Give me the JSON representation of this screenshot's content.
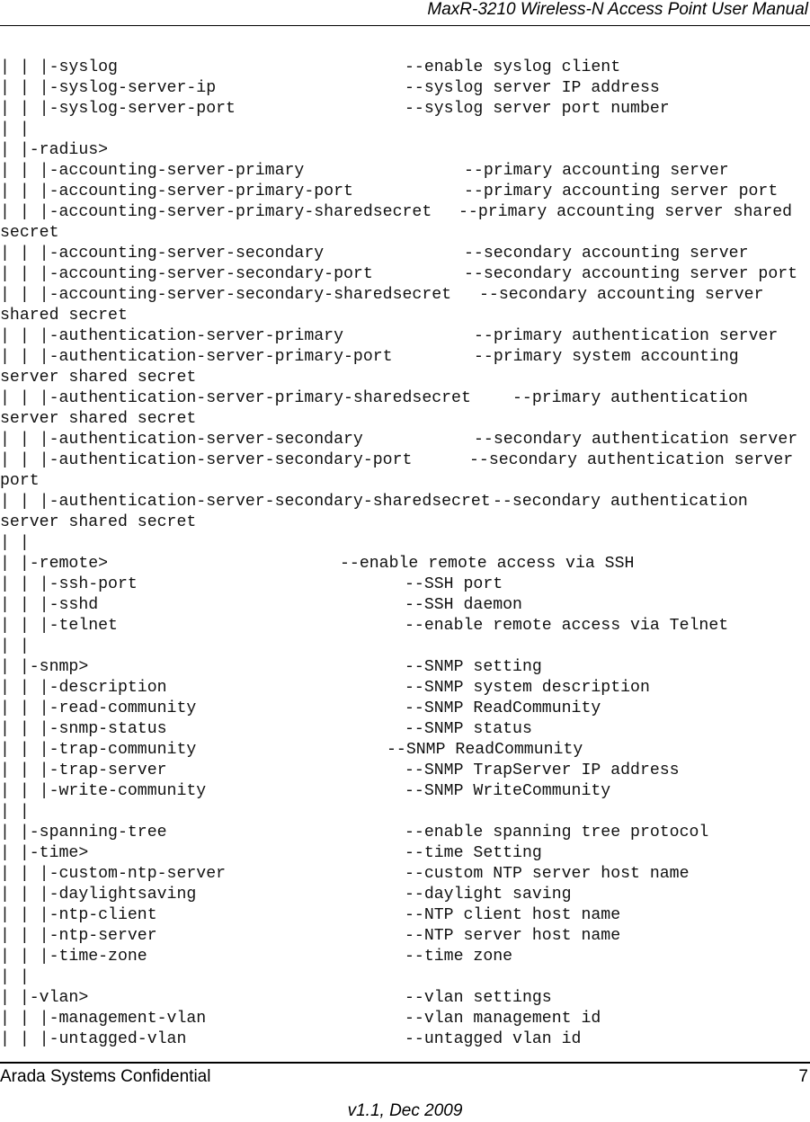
{
  "header": {
    "title": "MaxR-3210 Wireless-N Access Point User Manual"
  },
  "lines": [
    {
      "tree": "| | |-syslog",
      "desc": "--enable syslog client",
      "col": 450
    },
    {
      "tree": "| | |-syslog-server-ip",
      "desc": "--syslog server IP address",
      "col": 450
    },
    {
      "tree": "| | |-syslog-server-port",
      "desc": "--syslog server port number",
      "col": 450
    },
    {
      "tree": "| |",
      "desc": "",
      "col": 0
    },
    {
      "tree": "| |-radius>",
      "desc": "",
      "col": 0
    },
    {
      "tree": "| | |-accounting-server-primary",
      "desc": "--primary accounting server",
      "col": 516
    },
    {
      "tree": "| | |-accounting-server-primary-port",
      "desc": "--primary accounting server port",
      "col": 516
    },
    {
      "tree": "| | |-accounting-server-primary-sharedsecret",
      "desc": "--primary accounting server shared",
      "col": 510
    },
    {
      "tree": "secret",
      "desc": "",
      "col": 0
    },
    {
      "tree": "| | |-accounting-server-secondary",
      "desc": "--secondary accounting server",
      "col": 516
    },
    {
      "tree": "| | |-accounting-server-secondary-port",
      "desc": "--secondary accounting server port",
      "col": 516
    },
    {
      "tree": "| | |-accounting-server-secondary-sharedsecret",
      "desc": "--secondary accounting server",
      "col": 533
    },
    {
      "tree": "shared secret",
      "desc": "",
      "col": 0
    },
    {
      "tree": "| | |-authentication-server-primary",
      "desc": "--primary authentication server",
      "col": 527
    },
    {
      "tree": "| | |-authentication-server-primary-port",
      "desc": "--primary system accounting",
      "col": 527
    },
    {
      "tree": "server shared secret",
      "desc": "",
      "col": 0
    },
    {
      "tree": "| | |-authentication-server-primary-sharedsecret",
      "desc": "--primary authentication",
      "col": 570
    },
    {
      "tree": "server shared secret",
      "desc": "",
      "col": 0
    },
    {
      "tree": "| | |-authentication-server-secondary",
      "desc": "--secondary authentication server",
      "col": 527
    },
    {
      "tree": "| | |-authentication-server-secondary-port",
      "desc": "--secondary authentication server",
      "col": 522
    },
    {
      "tree": "port",
      "desc": "",
      "col": 0
    },
    {
      "tree": "| | |-authentication-server-secondary-sharedsecret",
      "desc": "--secondary authentication",
      "col": 548
    },
    {
      "tree": "server shared secret",
      "desc": "",
      "col": 0
    },
    {
      "tree": "| |",
      "desc": "",
      "col": 0
    },
    {
      "tree": "| |-remote>",
      "desc": "--enable remote access via SSH",
      "col": 378
    },
    {
      "tree": "| | |-ssh-port",
      "desc": "--SSH port",
      "col": 450
    },
    {
      "tree": "| | |-sshd",
      "desc": "--SSH daemon",
      "col": 450
    },
    {
      "tree": "| | |-telnet",
      "desc": "--enable remote access via Telnet",
      "col": 450
    },
    {
      "tree": "| |",
      "desc": "",
      "col": 0
    },
    {
      "tree": "| |-snmp>",
      "desc": "--SNMP setting",
      "col": 450
    },
    {
      "tree": "| | |-description",
      "desc": "--SNMP system description",
      "col": 450
    },
    {
      "tree": "| | |-read-community",
      "desc": "--SNMP ReadCommunity",
      "col": 450
    },
    {
      "tree": "| | |-snmp-status",
      "desc": "--SNMP status",
      "col": 450
    },
    {
      "tree": "| | |-trap-community",
      "desc": "--SNMP ReadCommunity",
      "col": 430
    },
    {
      "tree": "| | |-trap-server",
      "desc": "--SNMP TrapServer IP address",
      "col": 450
    },
    {
      "tree": "| | |-write-community",
      "desc": "--SNMP WriteCommunity",
      "col": 450
    },
    {
      "tree": "| |",
      "desc": "",
      "col": 0
    },
    {
      "tree": "| |-spanning-tree",
      "desc": "--enable spanning tree protocol",
      "col": 450
    },
    {
      "tree": "| |-time>",
      "desc": "--time Setting",
      "col": 450
    },
    {
      "tree": "| | |-custom-ntp-server",
      "desc": "--custom NTP server host name",
      "col": 450
    },
    {
      "tree": "| | |-daylightsaving",
      "desc": "--daylight saving",
      "col": 450
    },
    {
      "tree": "| | |-ntp-client",
      "desc": "--NTP client host name",
      "col": 450
    },
    {
      "tree": "| | |-ntp-server",
      "desc": "--NTP server host name",
      "col": 450
    },
    {
      "tree": "| | |-time-zone",
      "desc": "--time zone",
      "col": 450
    },
    {
      "tree": "| |",
      "desc": "",
      "col": 0
    },
    {
      "tree": "| |-vlan>",
      "desc": "--vlan settings",
      "col": 450
    },
    {
      "tree": "| | |-management-vlan",
      "desc": "--vlan management id",
      "col": 450
    },
    {
      "tree": "| | |-untagged-vlan",
      "desc": "--untagged vlan id",
      "col": 450
    }
  ],
  "footer": {
    "left": "Arada Systems Confidential",
    "page_number": "7",
    "version": "v1.1, Dec 2009"
  }
}
